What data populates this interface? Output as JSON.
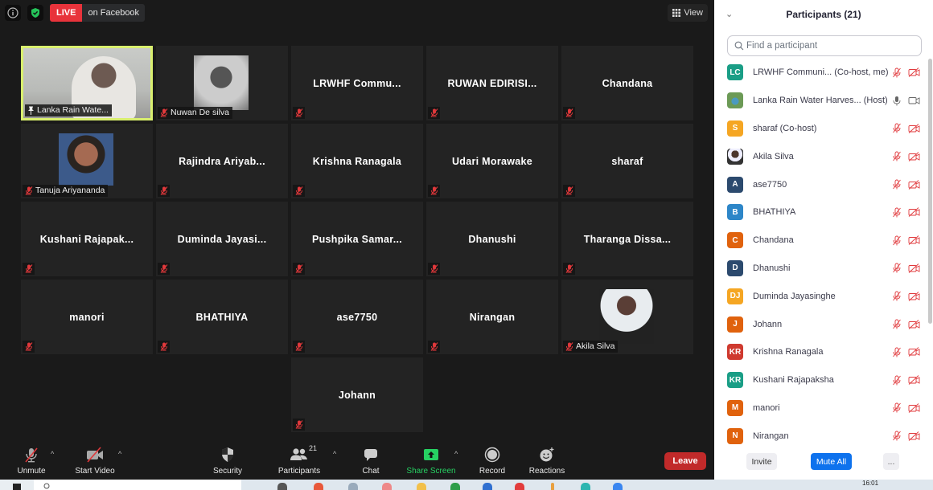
{
  "topbar": {
    "info_icon": "info-icon",
    "security_icon": "shield-check-icon",
    "live_label": "LIVE",
    "live_destination": "on Facebook",
    "view_label": "View",
    "view_icon": "grid-icon"
  },
  "gallery": {
    "tiles": [
      {
        "name": "Lanka Rain Wate...",
        "type": "video",
        "active": true,
        "label_icon": "pin-icon"
      },
      {
        "name": "Nuwan De silva",
        "type": "photo",
        "muted": true
      },
      {
        "name": "LRWHF  Commu...",
        "type": "text",
        "muted": true
      },
      {
        "name": "RUWAN  EDIRISI...",
        "type": "text",
        "muted": true
      },
      {
        "name": "Chandana",
        "type": "text",
        "muted": true
      },
      {
        "name": "Tanuja Ariyananda",
        "type": "photo",
        "muted": true
      },
      {
        "name": "Rajindra  Ariyab...",
        "type": "text",
        "muted": true
      },
      {
        "name": "Krishna Ranagala",
        "type": "text",
        "muted": true
      },
      {
        "name": "Udari Morawake",
        "type": "text",
        "muted": true
      },
      {
        "name": "sharaf",
        "type": "text",
        "muted": true
      },
      {
        "name": "Kushani  Rajapak...",
        "type": "text",
        "muted": true
      },
      {
        "name": "Duminda  Jayasi...",
        "type": "text",
        "muted": true
      },
      {
        "name": "Pushpika  Samar...",
        "type": "text",
        "muted": true
      },
      {
        "name": "Dhanushi",
        "type": "text",
        "muted": true
      },
      {
        "name": "Tharanga  Dissa...",
        "type": "text",
        "muted": true
      },
      {
        "name": "manori",
        "type": "text",
        "muted": true
      },
      {
        "name": "BHATHIYA",
        "type": "text",
        "muted": true
      },
      {
        "name": "ase7750",
        "type": "text",
        "muted": true
      },
      {
        "name": "Nirangan",
        "type": "text",
        "muted": true
      },
      {
        "name": "Akila Silva",
        "type": "photo",
        "muted": true
      },
      {
        "name": "Johann",
        "type": "text",
        "muted": true
      }
    ]
  },
  "toolbar": {
    "unmute": "Unmute",
    "start_video": "Start Video",
    "security": "Security",
    "participants": "Participants",
    "participants_count": "21",
    "chat": "Chat",
    "share_screen": "Share Screen",
    "record": "Record",
    "reactions": "Reactions",
    "leave": "Leave"
  },
  "panel": {
    "title": "Participants (21)",
    "search_placeholder": "Find a participant",
    "participants": [
      {
        "initials": "LC",
        "color": "#1a9e86",
        "name": "LRWHF Communi...  (Co-host, me)",
        "mic": "muted",
        "video": "off"
      },
      {
        "initials": "",
        "color": "#5a8a5a",
        "name": "Lanka Rain Water Harves...  (Host)",
        "mic": "on",
        "video": "on",
        "photo": true
      },
      {
        "initials": "S",
        "color": "#f5a623",
        "name": "sharaf (Co-host)",
        "mic": "muted",
        "video": "off"
      },
      {
        "initials": "",
        "color": "#888888",
        "name": "Akila Silva",
        "mic": "muted",
        "video": "off",
        "photo": true
      },
      {
        "initials": "A",
        "color": "#2c4a6e",
        "name": "ase7750",
        "mic": "muted",
        "video": "off"
      },
      {
        "initials": "B",
        "color": "#2d86c8",
        "name": "BHATHIYA",
        "mic": "muted",
        "video": "off"
      },
      {
        "initials": "C",
        "color": "#e0620d",
        "name": "Chandana",
        "mic": "muted",
        "video": "off"
      },
      {
        "initials": "D",
        "color": "#2c4a6e",
        "name": "Dhanushi",
        "mic": "muted",
        "video": "off"
      },
      {
        "initials": "DJ",
        "color": "#f5a623",
        "name": "Duminda Jayasinghe",
        "mic": "muted",
        "video": "off"
      },
      {
        "initials": "J",
        "color": "#e0620d",
        "name": "Johann",
        "mic": "muted",
        "video": "off"
      },
      {
        "initials": "KR",
        "color": "#cf3a2f",
        "name": "Krishna Ranagala",
        "mic": "muted",
        "video": "off"
      },
      {
        "initials": "KR",
        "color": "#1a9e86",
        "name": "Kushani Rajapaksha",
        "mic": "muted",
        "video": "off"
      },
      {
        "initials": "M",
        "color": "#e0620d",
        "name": "manori",
        "mic": "muted",
        "video": "off"
      },
      {
        "initials": "N",
        "color": "#e0620d",
        "name": "Nirangan",
        "mic": "muted",
        "video": "off"
      }
    ],
    "invite": "Invite",
    "mute_all": "Mute All",
    "more": "..."
  },
  "taskbar": {
    "clock": "16:01"
  }
}
